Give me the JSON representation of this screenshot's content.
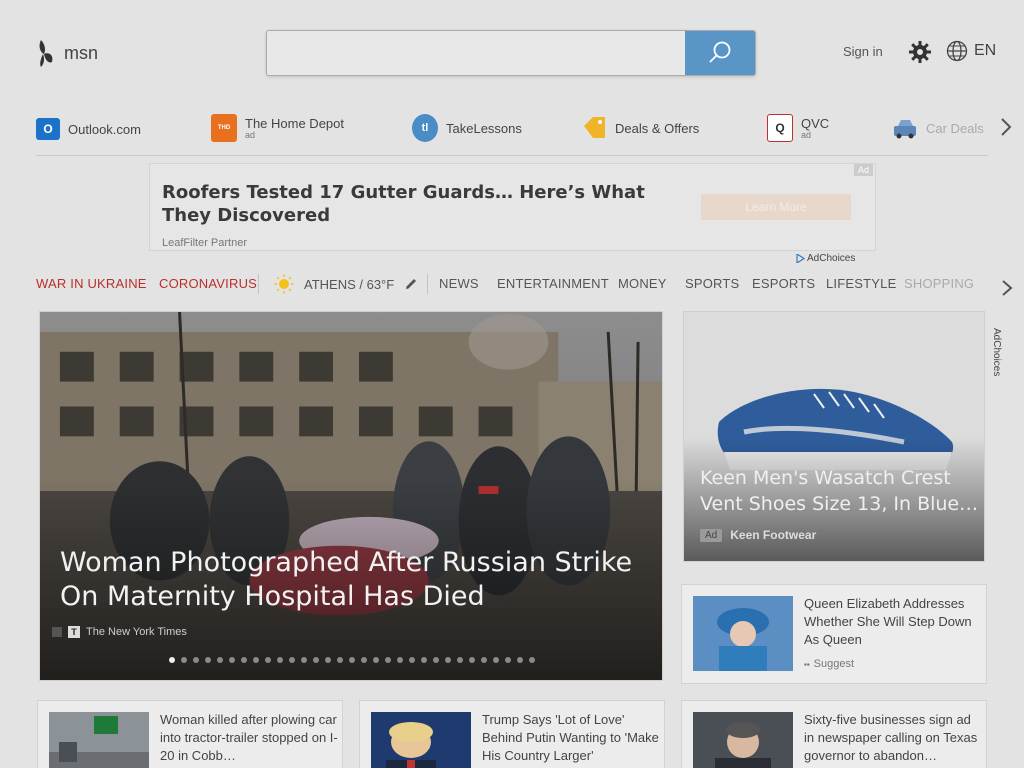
{
  "header": {
    "logo_text": "msn",
    "search_value": "",
    "search_placeholder": "",
    "signin_label": "Sign in",
    "language_label": "EN"
  },
  "quicklinks": [
    {
      "label": "Outlook.com",
      "ad": "",
      "icon": "outlook-icon",
      "color": "#1a73c8"
    },
    {
      "label": "The Home Depot",
      "ad": "ad",
      "icon": "home-depot-icon",
      "color": "#e8701e"
    },
    {
      "label": "TakeLessons",
      "ad": "",
      "icon": "takelessons-icon",
      "color": "#4a8cc6"
    },
    {
      "label": "Deals & Offers",
      "ad": "",
      "icon": "tag-icon",
      "color": "#f0b429"
    },
    {
      "label": "QVC",
      "ad": "ad",
      "icon": "qvc-icon",
      "color": "#c0302b"
    },
    {
      "label": "Car Deals",
      "ad": "",
      "icon": "car-icon",
      "color": "#5a86b8"
    }
  ],
  "ad_banner": {
    "title": "Roofers Tested 17 Gutter Guards… Here’s What They Discovered",
    "source": "LeafFilter Partner",
    "cta": "Learn More",
    "tag": "Ad",
    "adchoices": "AdChoices"
  },
  "categories": {
    "war": "WAR IN UKRAINE",
    "coronavirus": "CORONAVIRUS",
    "weather": "ATHENS / 63°F",
    "news": "NEWS",
    "entertainment": "ENTERTAINMENT",
    "money": "MONEY",
    "sports": "SPORTS",
    "esports": "ESPORTS",
    "lifestyle": "LIFESTYLE",
    "shopping": "SHOPPING"
  },
  "hero": {
    "title": "Woman Photographed After Russian Strike On Maternity Hospital Has Died",
    "source": "The New York Times",
    "dot_count": 31,
    "active_dot": 0
  },
  "ad_card": {
    "title": "Keen Men's Wasatch Crest Vent Shoes Size 13, In Blue…",
    "tag": "Ad",
    "source": "Keen Footwear",
    "adchoices": "AdChoices"
  },
  "cards": [
    {
      "title": "Queen Elizabeth Addresses Whether She Will Step Down As Queen",
      "source": "Suggest"
    },
    {
      "title": "Woman killed after plowing car into tractor-trailer stopped on I-20 in Cobb…",
      "source": ""
    },
    {
      "title": "Trump Says 'Lot of Love' Behind Putin Wanting to 'Make His Country Larger'",
      "source": ""
    },
    {
      "title": "Sixty-five businesses sign ad in newspaper calling on Texas governor to abandon…",
      "source": ""
    }
  ],
  "colors": {
    "accent": "#5a95c8",
    "red_category": "#b8302a"
  }
}
